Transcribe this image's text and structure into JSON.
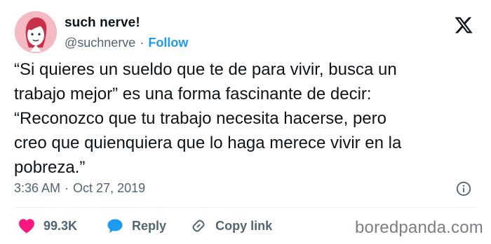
{
  "author": {
    "display_name": "such nerve!",
    "handle": "@suchnerve",
    "separator": "·",
    "follow_label": "Follow"
  },
  "tweet": {
    "lines": [
      "“Si quieres un sueldo que te de para vivir, busca un",
      "trabajo mejor” es una forma fascinante de decir:",
      "“Reconozco que tu trabajo necesita hacerse, pero",
      "creo que quienquiera que lo haga merece vivir en la",
      "pobreza.”"
    ],
    "time": "3:36 AM",
    "separator": "·",
    "date": "Oct 27, 2019"
  },
  "actions": {
    "likes": "99.3K",
    "reply_label": "Reply",
    "copy_link_label": "Copy link"
  },
  "watermark": "boredpanda.com",
  "icons": {
    "platform": "x-logo-icon",
    "info": "info-icon",
    "like": "heart-icon",
    "reply": "speech-bubble-icon",
    "copy": "link-icon"
  },
  "colors": {
    "accent": "#1d9bf0",
    "heart": "#f91880",
    "text": "#0f1419",
    "muted": "#536471",
    "avatar_bg": "#f4b9c2"
  }
}
